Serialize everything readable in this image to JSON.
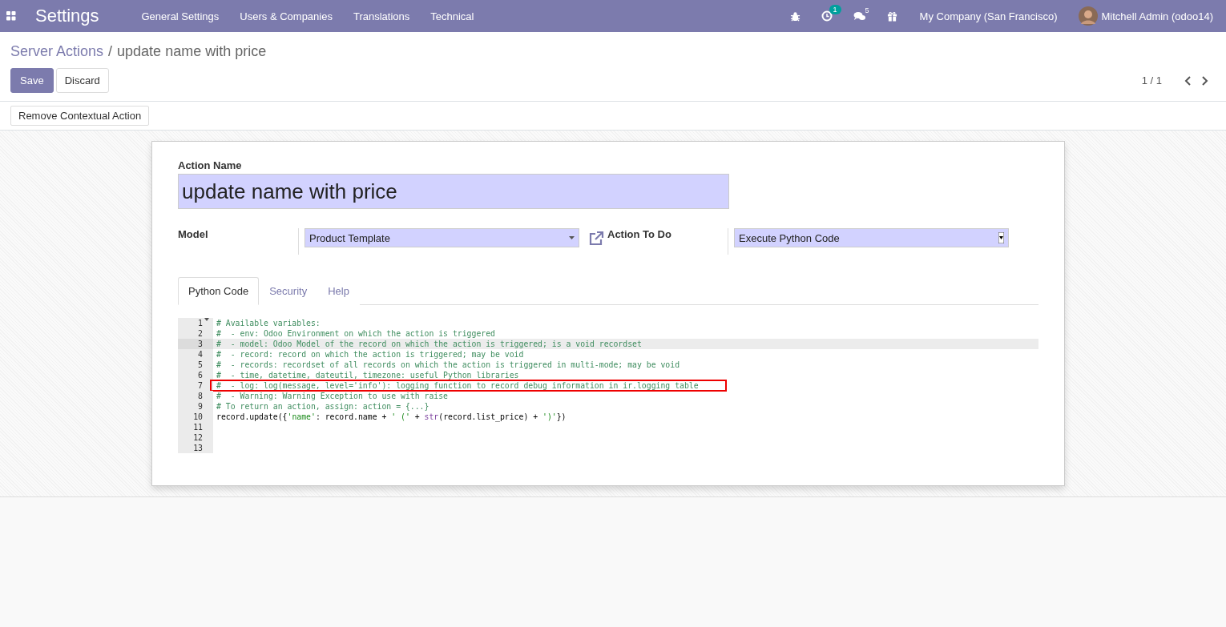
{
  "navbar": {
    "app_title": "Settings",
    "menus": [
      "General Settings",
      "Users & Companies",
      "Translations",
      "Technical"
    ],
    "activity_count": "1",
    "message_count": "5",
    "company": "My Company (San Francisco)",
    "user": "Mitchell Admin (odoo14)"
  },
  "breadcrumb": {
    "parent": "Server Actions",
    "separator": "/",
    "current": "update name with price"
  },
  "buttons": {
    "save": "Save",
    "discard": "Discard"
  },
  "pager": "1 / 1",
  "statusbar_button": "Remove Contextual Action",
  "form": {
    "name_label": "Action Name",
    "name_value": "update name with price",
    "model_label": "Model",
    "model_value": "Product Template",
    "action_label": "Action To Do",
    "action_value": "Execute Python Code"
  },
  "tabs": [
    {
      "label": "Python Code",
      "selected": true
    },
    {
      "label": "Security",
      "selected": false
    },
    {
      "label": "Help",
      "selected": false
    }
  ],
  "code_lines": [
    {
      "number": "1",
      "foldable": true,
      "active": false,
      "highlighted": false,
      "tokens": [
        {
          "kind": "comment",
          "text": "# Available variables:"
        }
      ]
    },
    {
      "number": "2",
      "foldable": false,
      "active": false,
      "highlighted": false,
      "tokens": [
        {
          "kind": "comment",
          "text": "#  - env: Odoo Environment on which the action is triggered"
        }
      ]
    },
    {
      "number": "3",
      "foldable": false,
      "active": true,
      "highlighted": false,
      "tokens": [
        {
          "kind": "comment",
          "text": "#  - model: Odoo Model of the record on which the action is triggered; is a void recordset"
        }
      ]
    },
    {
      "number": "4",
      "foldable": false,
      "active": false,
      "highlighted": false,
      "tokens": [
        {
          "kind": "comment",
          "text": "#  - record: record on which the action is triggered; may be void"
        }
      ]
    },
    {
      "number": "5",
      "foldable": false,
      "active": false,
      "highlighted": false,
      "tokens": [
        {
          "kind": "comment",
          "text": "#  - records: recordset of all records on which the action is triggered in multi-mode; may be void"
        }
      ]
    },
    {
      "number": "6",
      "foldable": false,
      "active": false,
      "highlighted": false,
      "tokens": [
        {
          "kind": "comment",
          "text": "#  - time, datetime, dateutil, timezone: useful Python libraries"
        }
      ]
    },
    {
      "number": "7",
      "foldable": false,
      "active": false,
      "highlighted": true,
      "tokens": [
        {
          "kind": "comment",
          "text": "#  - log: log(message, level='info'): logging function to record debug information in ir.logging table"
        }
      ]
    },
    {
      "number": "8",
      "foldable": false,
      "active": false,
      "highlighted": false,
      "tokens": [
        {
          "kind": "comment",
          "text": "#  - Warning: Warning Exception to use with raise"
        }
      ]
    },
    {
      "number": "9",
      "foldable": false,
      "active": false,
      "highlighted": false,
      "tokens": [
        {
          "kind": "comment",
          "text": "# To return an action, assign: action = {...}"
        }
      ]
    },
    {
      "number": "10",
      "foldable": false,
      "active": false,
      "highlighted": false,
      "tokens": [
        {
          "kind": "plain",
          "text": "record.update({"
        },
        {
          "kind": "string",
          "text": "'name'"
        },
        {
          "kind": "plain",
          "text": ": record.name + "
        },
        {
          "kind": "string",
          "text": "' ('"
        },
        {
          "kind": "plain",
          "text": " + "
        },
        {
          "kind": "builtin",
          "text": "str"
        },
        {
          "kind": "plain",
          "text": "(record.list_price) + "
        },
        {
          "kind": "string",
          "text": "')'"
        },
        {
          "kind": "plain",
          "text": "})"
        }
      ]
    },
    {
      "number": "11",
      "foldable": false,
      "active": false
    },
    {
      "number": "12",
      "foldable": false,
      "active": false
    },
    {
      "number": "13",
      "foldable": false,
      "active": false
    }
  ]
}
